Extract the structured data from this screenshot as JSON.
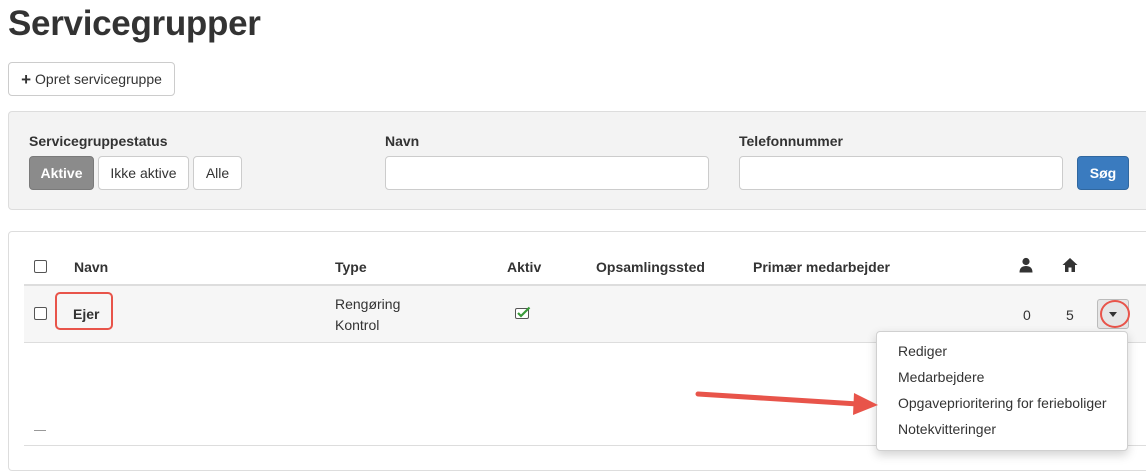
{
  "page": {
    "title": "Servicegrupper"
  },
  "actions": {
    "create_label": "Opret servicegruppe"
  },
  "filters": {
    "status_label": "Servicegruppestatus",
    "status_options": [
      "Aktive",
      "Ikke aktive",
      "Alle"
    ],
    "status_selected": "Aktive",
    "name_label": "Navn",
    "name_value": "",
    "phone_label": "Telefonnummer",
    "phone_value": "",
    "search_label": "Søg"
  },
  "table": {
    "headers": {
      "name": "Navn",
      "type": "Type",
      "active": "Aktiv",
      "pickup": "Opsamlingssted",
      "primary": "Primær medarbejder",
      "person_icon": "user-icon",
      "home_icon": "home-icon"
    },
    "rows": [
      {
        "name": "Ejer",
        "type_line1": "Rengøring",
        "type_line2": "Kontrol",
        "active": true,
        "pickup": "",
        "primary": "",
        "persons": "0",
        "homes": "5"
      }
    ]
  },
  "row_menu": {
    "items": [
      "Rediger",
      "Medarbejdere",
      "Opgaveprioritering for ferieboliger",
      "Notekvitteringer"
    ]
  },
  "colors": {
    "accent_blue": "#3a7bbf",
    "selected_gray": "#8b8b8b",
    "annotation_red": "#e8544a",
    "check_green": "#3a9a3a"
  }
}
